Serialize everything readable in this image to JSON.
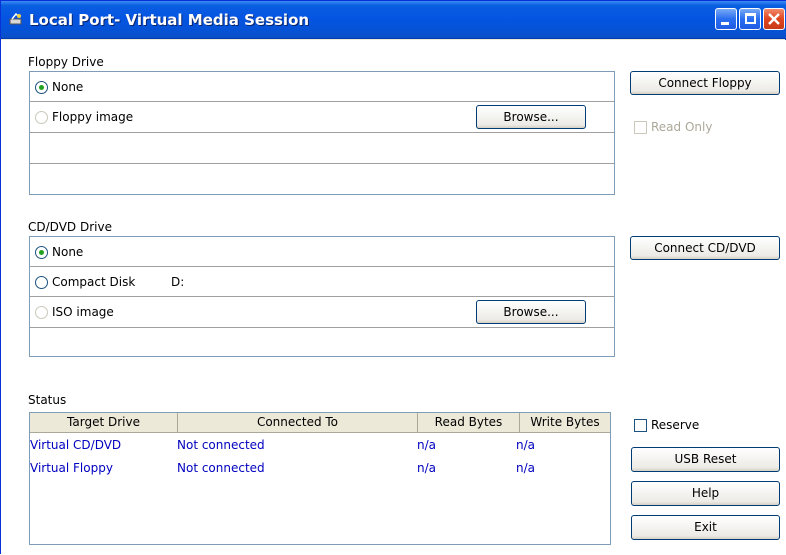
{
  "window": {
    "title": "Local Port- Virtual Media Session"
  },
  "floppy": {
    "section_label": "Floppy Drive",
    "options": [
      {
        "label": "None",
        "checked": true,
        "enabled": true
      },
      {
        "label": "Floppy image",
        "checked": false,
        "enabled": false
      }
    ],
    "browse_label": "Browse...",
    "connect_label": "Connect Floppy",
    "read_only_label": "Read Only"
  },
  "cddvd": {
    "section_label": "CD/DVD Drive",
    "options": [
      {
        "label": "None",
        "checked": true,
        "enabled": true
      },
      {
        "label": "Compact Disk",
        "checked": false,
        "enabled": true,
        "drive_letter": "D:"
      },
      {
        "label": "ISO image",
        "checked": false,
        "enabled": false
      }
    ],
    "browse_label": "Browse...",
    "connect_label": "Connect CD/DVD"
  },
  "status": {
    "section_label": "Status",
    "columns": [
      "Target Drive",
      "Connected To",
      "Read Bytes",
      "Write Bytes"
    ],
    "rows": [
      [
        "Virtual CD/DVD",
        "Not connected",
        "n/a",
        "n/a"
      ],
      [
        "Virtual Floppy",
        "Not connected",
        "n/a",
        "n/a"
      ]
    ]
  },
  "side": {
    "reserve_label": "Reserve",
    "usb_reset_label": "USB Reset",
    "help_label": "Help",
    "exit_label": "Exit"
  },
  "colors": {
    "title_bar": "#0554e3",
    "status_text": "#0000c0",
    "radio_dot": "#21a121"
  },
  "icons": [
    "app-icon",
    "minimize-icon",
    "maximize-icon",
    "close-icon"
  ]
}
